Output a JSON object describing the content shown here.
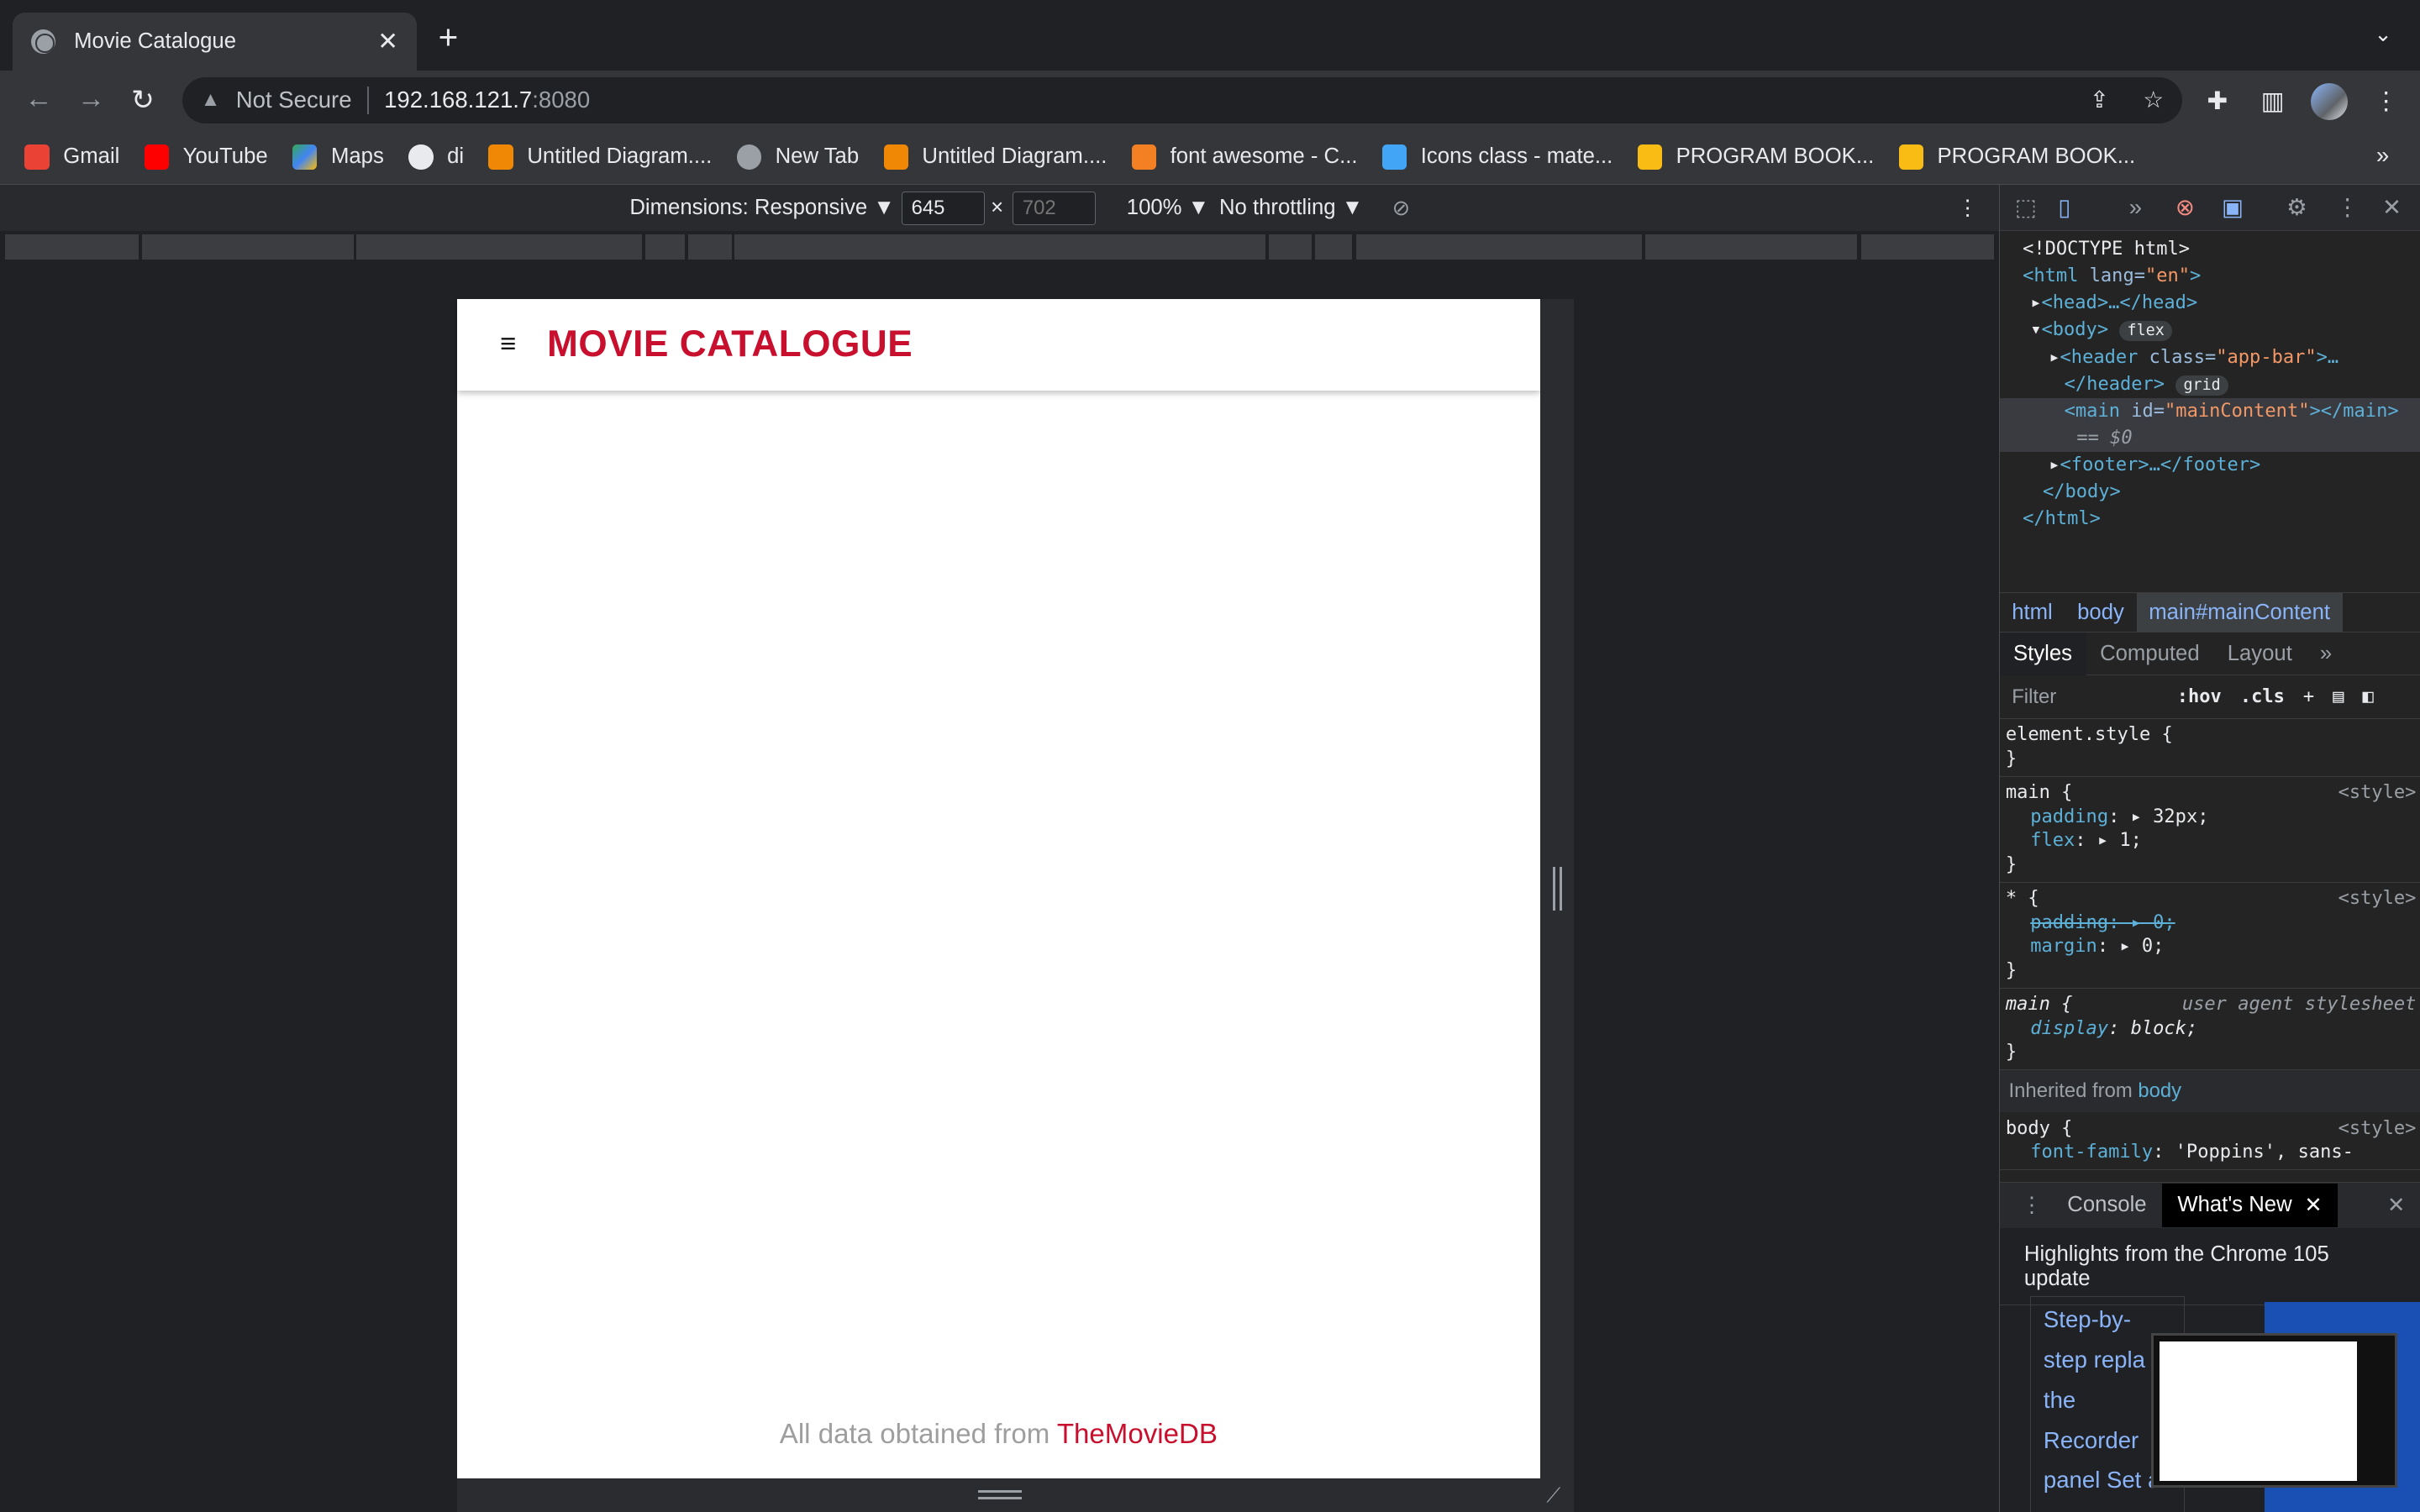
{
  "browser": {
    "tab_title": "Movie Catalogue",
    "tab_close": "✕",
    "new_tab": "+",
    "tab_menu": "⌄",
    "security_label": "Not Secure",
    "url_host": "192.168.121.7",
    "url_port": ":8080",
    "bookmarks": [
      {
        "label": "Gmail",
        "color": "#ea4335"
      },
      {
        "label": "YouTube",
        "color": "#ff0000"
      },
      {
        "label": "Maps",
        "color": "#34a853"
      },
      {
        "label": "di",
        "color": "#e8eaed"
      },
      {
        "label": "Untitled Diagram....",
        "color": "#f08705"
      },
      {
        "label": "New Tab",
        "color": "#9aa0a6"
      },
      {
        "label": "Untitled Diagram....",
        "color": "#f08705"
      },
      {
        "label": "font awesome - C...",
        "color": "#f48024"
      },
      {
        "label": "Icons class - mate...",
        "color": "#42a5f5"
      },
      {
        "label": "PROGRAM BOOK...",
        "color": "#f9bc15"
      },
      {
        "label": "PROGRAM BOOK...",
        "color": "#f9bc15"
      }
    ],
    "bookmarks_more": "»"
  },
  "device_toolbar": {
    "dimensions_label": "Dimensions: Responsive ▼",
    "width_value": "645",
    "times": "×",
    "height_placeholder": "702",
    "zoom_label": "100% ▼",
    "throttle_label": "No throttling ▼"
  },
  "page": {
    "menu_icon": "≡",
    "logo_text": "MOVIE CATALOGUE",
    "footer_prefix": "All data obtained from ",
    "footer_link": "TheMovieDB",
    "accent_color": "#c8102e"
  },
  "devtools": {
    "dom_lines": {
      "doctype": "<!DOCTYPE html>",
      "html_open_tag": "<html",
      "html_attr": " lang=",
      "html_attr_val": "\"en\"",
      "html_close": ">",
      "head": "<head>…</head>",
      "body_open": "<body>",
      "body_badge": "flex",
      "header_open": "<header",
      "header_attr": " class=",
      "header_attr_val": "\"app-bar\"",
      "header_ellipsis": ">…",
      "header_close": "</header>",
      "header_badge": "grid",
      "main_open": "<main",
      "main_attr": " id=",
      "main_attr_val": "\"mainContent\"",
      "main_close": "></main>",
      "main_eq": "== $0",
      "footer": "<footer>…</footer>",
      "body_close": "</body>",
      "html_end": "</html>"
    },
    "breadcrumbs": [
      "html",
      "body",
      "main#mainContent"
    ],
    "style_tabs": [
      "Styles",
      "Computed",
      "Layout",
      "»"
    ],
    "filter_placeholder": "Filter",
    "filter_hov": ":hov",
    "filter_cls": ".cls",
    "rules": {
      "element_style": "element.style {",
      "close": "}",
      "main_sel": "main {",
      "main_src": "<style>",
      "main_p1_name": "padding",
      "main_p1_val": ": ▸ 32px;",
      "main_p2_name": "flex",
      "main_p2_val": ": ▸ 1;",
      "star_sel": "* {",
      "star_src": "<style>",
      "star_p1": "padding: ▸ 0;",
      "star_p2_name": "margin",
      "star_p2_val": ": ▸ 0;",
      "ua_sel": "main {",
      "ua_src": "user agent stylesheet",
      "ua_p_name": "display",
      "ua_p_val": ": block;",
      "inherited_prefix": "Inherited from ",
      "inherited_el": "body",
      "body_sel": "body {",
      "body_src": "<style>",
      "body_p_name": "font-family",
      "body_p_val": ": 'Poppins', sans-"
    },
    "drawer_console": "Console",
    "drawer_whatsnew": "What's New",
    "whatsnew_heading": "Highlights from the Chrome 105 update",
    "card_text": "Step-by-step repla in the Recorder panel Set a"
  }
}
